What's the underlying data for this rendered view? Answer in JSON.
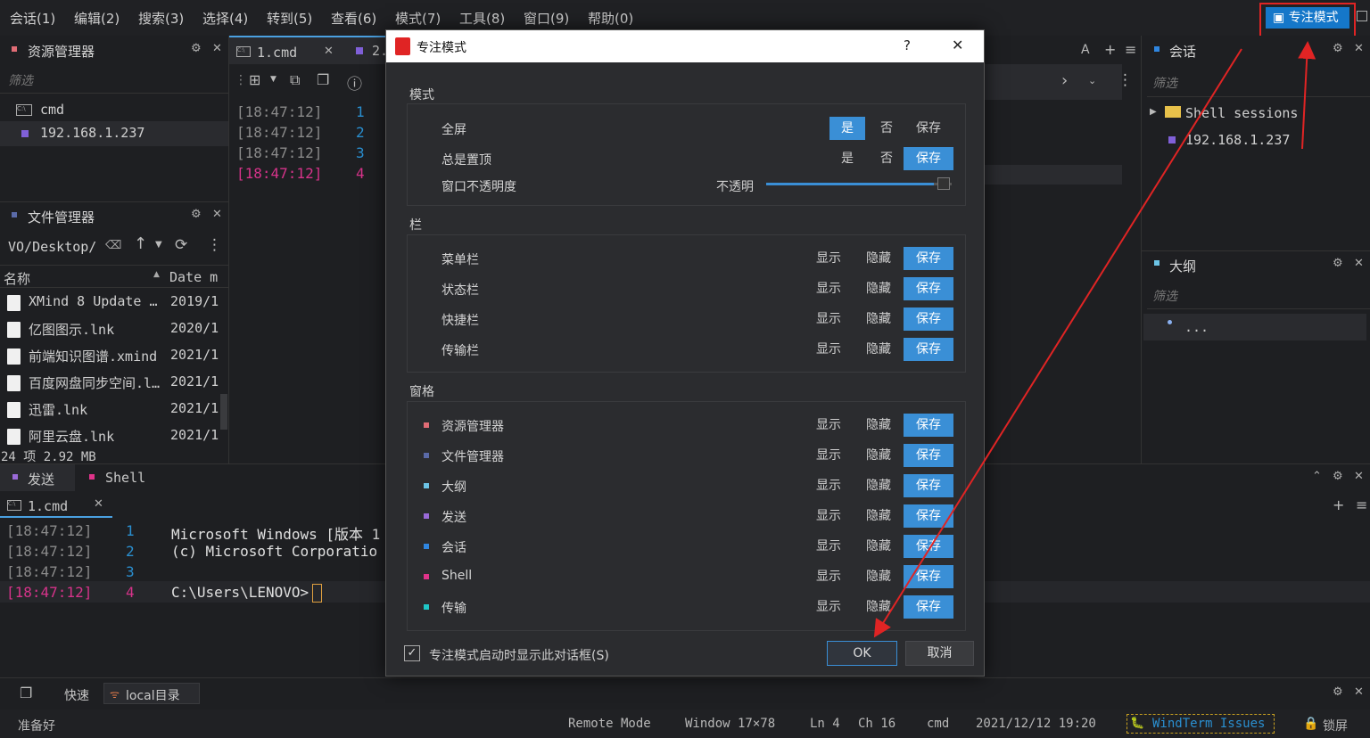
{
  "menu": [
    "会话(1)",
    "编辑(2)",
    "搜索(3)",
    "选择(4)",
    "转到(5)",
    "查看(6)",
    "模式(7)",
    "工具(8)",
    "窗口(9)",
    "帮助(0)"
  ],
  "focus_button": "专注模式",
  "explorer": {
    "title": "资源管理器",
    "filter": "筛选",
    "items": [
      "cmd",
      "192.168.1.237"
    ]
  },
  "file_manager": {
    "title": "文件管理器",
    "path": "VO/Desktop/",
    "columns": [
      "名称",
      "Date m"
    ],
    "rows": [
      {
        "name": "XMind 8 Update …",
        "date": "2019/1"
      },
      {
        "name": "亿图图示.lnk",
        "date": "2020/1"
      },
      {
        "name": "前端知识图谱.xmind",
        "date": "2021/1"
      },
      {
        "name": "百度网盘同步空间.l…",
        "date": "2021/1"
      },
      {
        "name": "迅雷.lnk",
        "date": "2021/1"
      },
      {
        "name": "阿里云盘.lnk",
        "date": "2021/1"
      }
    ],
    "summary": "24 项 2.92 MB"
  },
  "tabs": {
    "tab1": "1.cmd",
    "tab2": "2."
  },
  "terminal_top": {
    "lines": [
      {
        "ts": "[18:47:12]",
        "n": "1"
      },
      {
        "ts": "[18:47:12]",
        "n": "2"
      },
      {
        "ts": "[18:47:12]",
        "n": "3"
      },
      {
        "ts": "[18:47:12]",
        "n": "4"
      }
    ]
  },
  "right_panel_icons": {
    "a": "A",
    "plus": "+",
    "menu": "≡"
  },
  "session": {
    "title": "会话",
    "filter": "筛选",
    "group": "Shell sessions",
    "item": "192.168.1.237"
  },
  "outline": {
    "title": "大纲",
    "filter": "筛选",
    "item": "..."
  },
  "bottom": {
    "tab_send": "发送",
    "tab_shell": "Shell",
    "terminal_tab": "1.cmd",
    "lines": [
      {
        "ts": "[18:47:12]",
        "n": "1",
        "text": "Microsoft Windows [版本 1"
      },
      {
        "ts": "[18:47:12]",
        "n": "2",
        "text": "(c) Microsoft Corporatio"
      },
      {
        "ts": "[18:47:12]",
        "n": "3",
        "text": ""
      },
      {
        "ts": "[18:47:12]",
        "n": "4",
        "text": "C:\\Users\\LENOVO>"
      }
    ],
    "quick": "快速",
    "local": "local目录"
  },
  "dialog": {
    "title": "专注模式",
    "help": "?",
    "close": "✕",
    "mode_section": "模式",
    "mode_rows": [
      {
        "label": "全屏",
        "opts": [
          "是",
          "否",
          "保存"
        ],
        "selected": 0
      },
      {
        "label": "总是置顶",
        "opts": [
          "是",
          "否",
          "保存"
        ],
        "selected": 2
      }
    ],
    "opacity_label": "窗口不透明度",
    "opacity_value_label": "不透明",
    "opacity_level": 0.95,
    "bars_section": "栏",
    "bars": [
      "菜单栏",
      "状态栏",
      "快捷栏",
      "传输栏"
    ],
    "panes_section": "窗格",
    "panes": [
      {
        "label": "资源管理器",
        "color": "#e06c75"
      },
      {
        "label": "文件管理器",
        "color": "#5a6aa8"
      },
      {
        "label": "大纲",
        "color": "#6cc4e6"
      },
      {
        "label": "发送",
        "color": "#9a6ad8"
      },
      {
        "label": "会话",
        "color": "#2f86e0"
      },
      {
        "label": "Shell",
        "color": "#e0338a"
      },
      {
        "label": "传输",
        "color": "#1fc6c6"
      }
    ],
    "show": "显示",
    "hide": "隐藏",
    "save": "保存",
    "checkbox_label": "专注模式启动时显示此对话框(S)",
    "ok": "OK",
    "cancel": "取消"
  },
  "status": {
    "ready": "准备好",
    "mode": "Remote Mode",
    "window": "Window 17×78",
    "ln": "Ln 4",
    "ch": "Ch 16",
    "shell": "cmd",
    "datetime": "2021/12/12 19:20",
    "issues": "WindTerm Issues",
    "lock": "锁屏"
  },
  "colors": {
    "accent": "#3a8fd6",
    "annotation": "#e02424"
  }
}
